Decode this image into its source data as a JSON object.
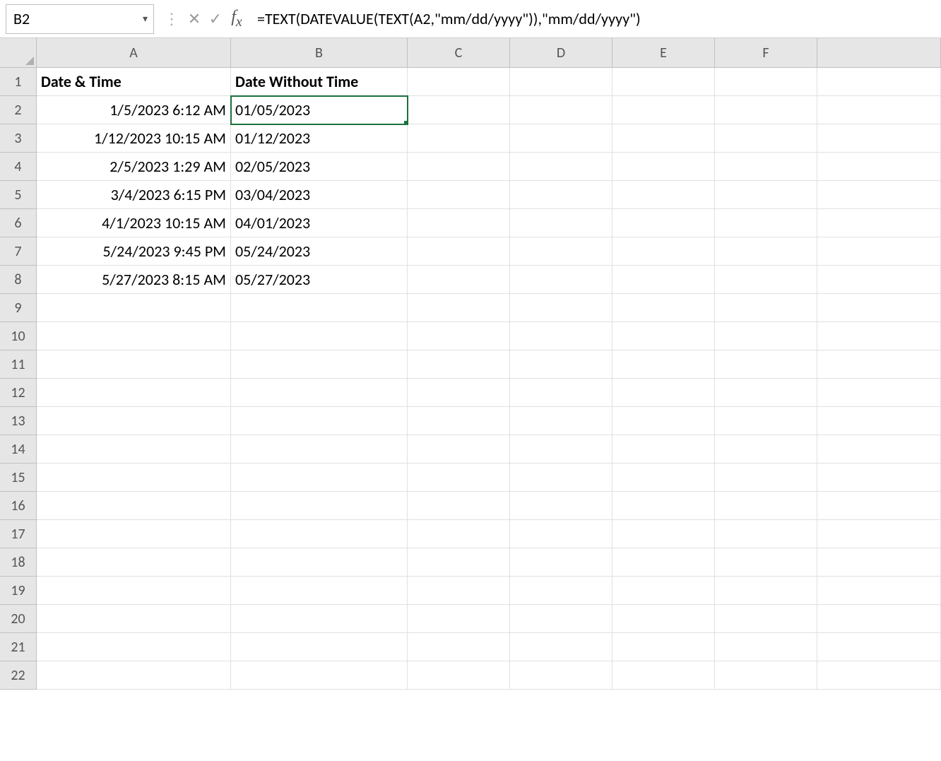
{
  "nameBox": "B2",
  "formula": "=TEXT(DATEVALUE(TEXT(A2,\"mm/dd/yyyy\")),\"mm/dd/yyyy\")",
  "columns": [
    "A",
    "B",
    "C",
    "D",
    "E",
    "F"
  ],
  "columnWidths": {
    "A": 275,
    "B": 250,
    "C": 145,
    "D": 145,
    "E": 145,
    "F": 145,
    "G": 175
  },
  "rowCount": 22,
  "selectedCell": "B2",
  "headers": {
    "A": "Date & Time",
    "B": "Date Without Time"
  },
  "rows": [
    {
      "A": "1/5/2023 6:12 AM",
      "B": "01/05/2023"
    },
    {
      "A": "1/12/2023 10:15 AM",
      "B": "01/12/2023"
    },
    {
      "A": "2/5/2023 1:29 AM",
      "B": "02/05/2023"
    },
    {
      "A": "3/4/2023 6:15 PM",
      "B": "03/04/2023"
    },
    {
      "A": "4/1/2023 10:15 AM",
      "B": "04/01/2023"
    },
    {
      "A": "5/24/2023 9:45 PM",
      "B": "05/24/2023"
    },
    {
      "A": "5/27/2023 8:15 AM",
      "B": "05/27/2023"
    }
  ]
}
